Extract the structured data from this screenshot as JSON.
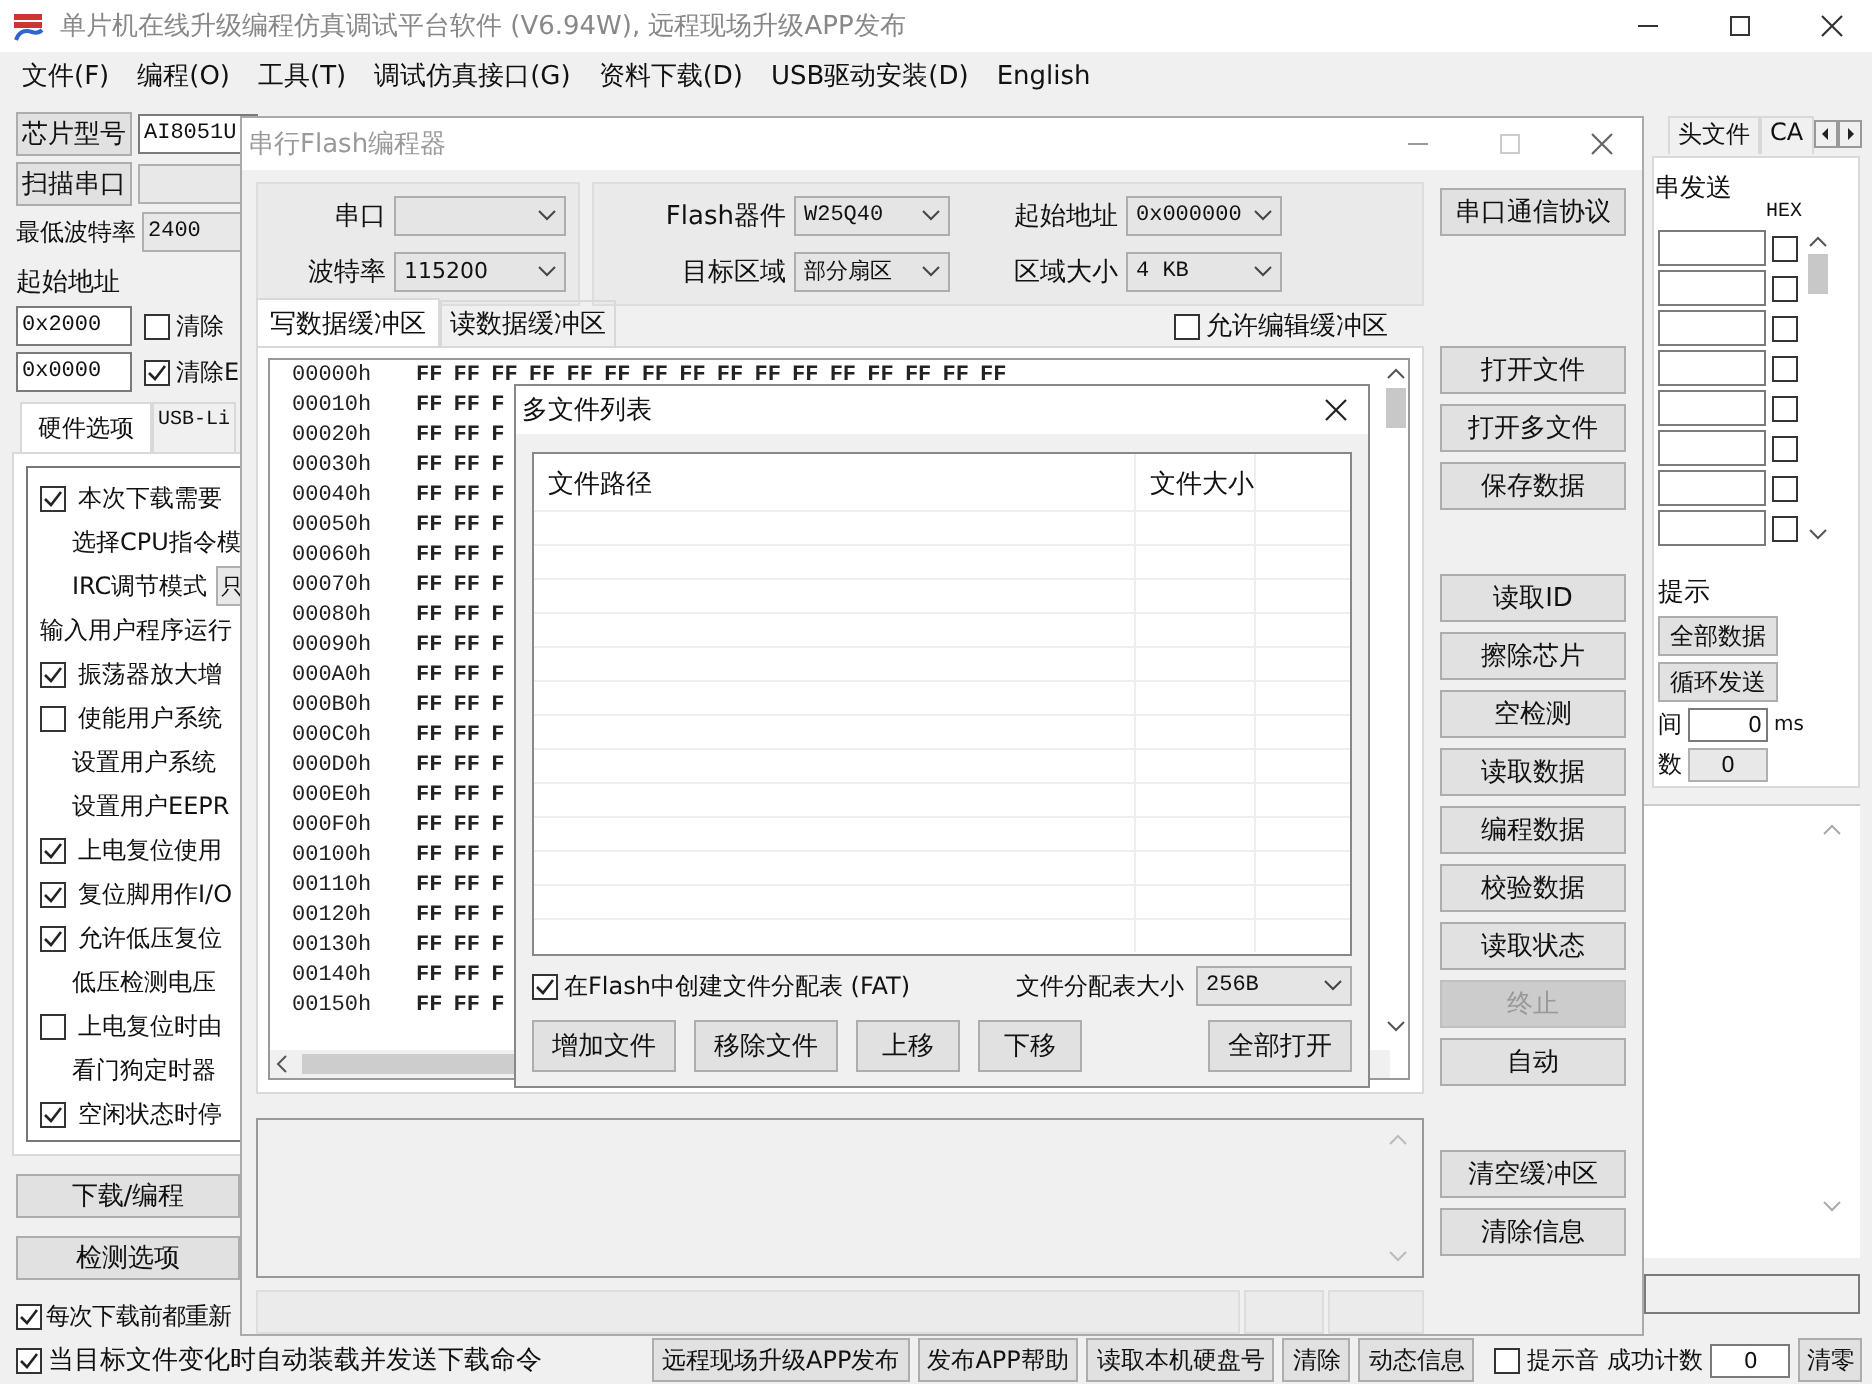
{
  "window": {
    "title": "单片机在线升级编程仿真调试平台软件 (V6.94W), 远程现场升级APP发布"
  },
  "menu": [
    "文件(F)",
    "编程(O)",
    "工具(T)",
    "调试仿真接口(G)",
    "资料下载(D)",
    "USB驱动安装(D)",
    "English"
  ],
  "left_panel": {
    "chip_button": "芯片型号",
    "chip_value": "AI8051U",
    "scan_button": "扫描串口",
    "min_baud_label": "最低波特率",
    "min_baud_value": "2400",
    "start_address_label": "起始地址",
    "address_rows": [
      {
        "value": "0x2000",
        "label": "清除",
        "checked": false
      },
      {
        "value": "0x0000",
        "label": "清除E",
        "checked": true
      }
    ],
    "tabs": [
      {
        "label": "硬件选项",
        "selected": true
      },
      {
        "label": "USB-Li",
        "selected": false
      }
    ],
    "options": [
      {
        "kind": "checkbox",
        "label": "本次下载需要",
        "checked": true
      },
      {
        "kind": "text",
        "label": "选择CPU指令模"
      },
      {
        "kind": "select",
        "label": "IRC调节模式",
        "value": "只"
      },
      {
        "kind": "plain",
        "label": "输入用户程序运行"
      },
      {
        "kind": "checkbox",
        "label": "振荡器放大增",
        "checked": true
      },
      {
        "kind": "checkbox",
        "label": "使能用户系统",
        "checked": false
      },
      {
        "kind": "text",
        "label": "设置用户系统"
      },
      {
        "kind": "text",
        "label": "设置用户EEPR"
      },
      {
        "kind": "checkbox",
        "label": "上电复位使用",
        "checked": true
      },
      {
        "kind": "checkbox",
        "label": "复位脚用作I/O",
        "checked": true
      },
      {
        "kind": "checkbox",
        "label": "允许低压复位",
        "checked": true
      },
      {
        "kind": "text",
        "label": "低压检测电压"
      },
      {
        "kind": "checkbox",
        "label": "上电复位时由",
        "checked": false
      },
      {
        "kind": "text",
        "label": "看门狗定时器"
      },
      {
        "kind": "checkbox",
        "label": "空闲状态时停",
        "checked": true
      }
    ],
    "buttons": [
      "下载/编程",
      "检测选项"
    ],
    "checks": [
      {
        "label": "每次下载前都重新",
        "checked": true
      }
    ]
  },
  "right_panel": {
    "tabs": [
      {
        "label": "头文件",
        "selected": false
      },
      {
        "label": "CA",
        "selected": false
      }
    ],
    "group_title": "串发送",
    "hex_label": "HEX",
    "send_rows": [
      {
        "checked": false
      },
      {
        "checked": false
      },
      {
        "checked": false
      },
      {
        "checked": false
      },
      {
        "checked": false
      },
      {
        "checked": false
      },
      {
        "checked": false
      },
      {
        "checked": false
      }
    ],
    "hint_label": "提示",
    "buttons": [
      "全部数据",
      "循环发送"
    ],
    "interval_label": "间",
    "interval_value": "0",
    "interval_unit": "ms",
    "count_label": "数",
    "count_value": "0"
  },
  "bottom_bar": {
    "auto_load": {
      "label": "当目标文件变化时自动装载并发送下载命令",
      "checked": true
    },
    "buttons": [
      "远程现场升级APP发布",
      "发布APP帮助",
      "读取本机硬盘号",
      "清除",
      "动态信息"
    ],
    "sound": {
      "label": "提示音",
      "checked": false
    },
    "success_label": "成功计数",
    "success_value": "0",
    "reset_button": "清零"
  },
  "flash_dialog": {
    "title": "串行Flash编程器",
    "port_fields": [
      {
        "label": "串口"
      },
      {
        "label": "波特率",
        "value": "115200"
      }
    ],
    "device_fields": [
      {
        "label": "Flash器件",
        "value": "W25Q40"
      },
      {
        "label": "起始地址",
        "value": "0x000000"
      },
      {
        "label": "目标区域",
        "value": "部分扇区"
      },
      {
        "label": "区域大小",
        "value": "4 KB"
      }
    ],
    "protocol_button": "串口通信协议",
    "tabs": [
      {
        "label": "写数据缓冲区",
        "selected": true
      },
      {
        "label": "读数据缓冲区",
        "selected": false
      }
    ],
    "allow_edit": {
      "label": "允许编辑缓冲区",
      "checked": false
    },
    "hex_rows": [
      {
        "address": "00000h",
        "bytes": "FF FF FF FF FF FF FF FF FF FF FF FF FF FF FF FF"
      },
      {
        "address": "00010h",
        "bytes": "FF FF F"
      },
      {
        "address": "00020h",
        "bytes": "FF FF F"
      },
      {
        "address": "00030h",
        "bytes": "FF FF F"
      },
      {
        "address": "00040h",
        "bytes": "FF FF F"
      },
      {
        "address": "00050h",
        "bytes": "FF FF F"
      },
      {
        "address": "00060h",
        "bytes": "FF FF F"
      },
      {
        "address": "00070h",
        "bytes": "FF FF F"
      },
      {
        "address": "00080h",
        "bytes": "FF FF F"
      },
      {
        "address": "00090h",
        "bytes": "FF FF F"
      },
      {
        "address": "000A0h",
        "bytes": "FF FF F"
      },
      {
        "address": "000B0h",
        "bytes": "FF FF F"
      },
      {
        "address": "000C0h",
        "bytes": "FF FF F"
      },
      {
        "address": "000D0h",
        "bytes": "FF FF F"
      },
      {
        "address": "000E0h",
        "bytes": "FF FF F"
      },
      {
        "address": "000F0h",
        "bytes": "FF FF F"
      },
      {
        "address": "00100h",
        "bytes": "FF FF F"
      },
      {
        "address": "00110h",
        "bytes": "FF FF F"
      },
      {
        "address": "00120h",
        "bytes": "FF FF F"
      },
      {
        "address": "00130h",
        "bytes": "FF FF F"
      },
      {
        "address": "00140h",
        "bytes": "FF FF F"
      },
      {
        "address": "00150h",
        "bytes": "FF FF F"
      }
    ],
    "button_groups": [
      [
        {
          "label": "打开文件",
          "disabled": false
        },
        {
          "label": "打开多文件",
          "disabled": false
        },
        {
          "label": "保存数据",
          "disabled": false
        }
      ],
      [
        {
          "label": "读取ID",
          "disabled": false
        },
        {
          "label": "擦除芯片",
          "disabled": false
        },
        {
          "label": "空检测",
          "disabled": false
        },
        {
          "label": "读取数据",
          "disabled": false
        },
        {
          "label": "编程数据",
          "disabled": false
        },
        {
          "label": "校验数据",
          "disabled": false
        },
        {
          "label": "读取状态",
          "disabled": false
        },
        {
          "label": "终止",
          "disabled": true
        },
        {
          "label": "自动",
          "disabled": false
        }
      ],
      [
        {
          "label": "清空缓冲区",
          "disabled": false
        },
        {
          "label": "清除信息",
          "disabled": false
        }
      ]
    ]
  },
  "file_dialog": {
    "title": "多文件列表",
    "columns": [
      "文件路径",
      "文件大小"
    ],
    "fat": {
      "label": "在Flash中创建文件分配表 (FAT)",
      "checked": true
    },
    "fat_size_label": "文件分配表大小",
    "fat_size_value": "256B",
    "buttons": [
      "增加文件",
      "移除文件",
      "上移",
      "下移"
    ],
    "open_all_button": "全部打开"
  }
}
